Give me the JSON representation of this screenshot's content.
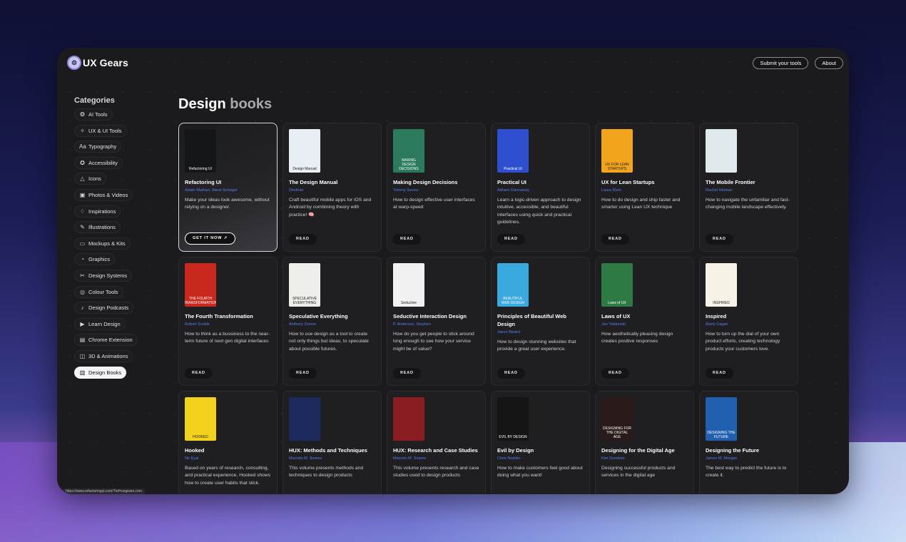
{
  "app": {
    "name": "UX Gears"
  },
  "header": {
    "submit_label": "Submit your tools",
    "about_label": "About"
  },
  "sidebar": {
    "title": "Categories",
    "items": [
      {
        "label": "AI Tools",
        "icon": "ai-icon"
      },
      {
        "label": "UX & UI Tools",
        "icon": "magic-icon"
      },
      {
        "label": "Typography",
        "icon": "typography-icon"
      },
      {
        "label": "Accessibility",
        "icon": "accessibility-icon"
      },
      {
        "label": "Icons",
        "icon": "triangle-icon"
      },
      {
        "label": "Photos & Videos",
        "icon": "photo-icon"
      },
      {
        "label": "Inspirations",
        "icon": "bulb-icon"
      },
      {
        "label": "Illustrations",
        "icon": "brush-icon"
      },
      {
        "label": "Mockups & Kits",
        "icon": "devices-icon"
      },
      {
        "label": "Graphics",
        "icon": "graphics-icon"
      },
      {
        "label": "Design Systems",
        "icon": "components-icon"
      },
      {
        "label": "Colour Tools",
        "icon": "palette-icon"
      },
      {
        "label": "Design Podcasts",
        "icon": "music-icon"
      },
      {
        "label": "Learn Design",
        "icon": "play-icon"
      },
      {
        "label": "Chrome Extension",
        "icon": "browser-icon"
      },
      {
        "label": "3D & Animations",
        "icon": "cube-icon"
      },
      {
        "label": "Design Books",
        "icon": "books-icon",
        "active": true
      }
    ]
  },
  "page": {
    "title_strong": "Design",
    "title_muted": "books"
  },
  "books": [
    {
      "title": "Refactoring UI",
      "author": "Adam Wathan, Steve Schoger",
      "desc": "Make your ideas look awesome, without relying on a designer.",
      "cta": "GET IT NOW",
      "cover_text": "Refactoring UI",
      "cover_color": "#15161a"
    },
    {
      "title": "The Design Manual",
      "author": "Diedrian",
      "desc": "Craft beautiful mobile apps for iOS and Android by combining theory with practice! 🧠",
      "cta": "READ",
      "cover_text": "Design Manual",
      "cover_color": "#e9eef5"
    },
    {
      "title": "Making Design Decisions",
      "author": "Tommy Geoco",
      "desc": "How to design effective user interfaces at warp-speed",
      "cta": "READ",
      "cover_text": "MAKING DESIGN DECISIONS",
      "cover_color": "#2b7a5c"
    },
    {
      "title": "Practical UI",
      "author": "Adham Dannaway",
      "desc": "Learn a logic-driven approach to design intuitive, accessible, and beautiful interfaces using quick and practical guidelines.",
      "cta": "READ",
      "cover_text": "Practical UI",
      "cover_color": "#2f4fd1"
    },
    {
      "title": "UX for Lean Startups",
      "author": "Laura Klein",
      "desc": "How to do design and ship faster and smarter using Lean UX technique",
      "cta": "READ",
      "cover_text": "UX FOR LEAN STARTUPS",
      "cover_color": "#f2a41c"
    },
    {
      "title": "The Mobile Frontier",
      "author": "Rachel Hinman",
      "desc": "How to navigate the unfamiliar and fast-changing mobile landscape effectively.",
      "cta": "READ",
      "cover_text": "",
      "cover_color": "#dfe8ea"
    },
    {
      "title": "The Fourth Transformation",
      "author": "Robert Scoble",
      "desc": "How to think as a bussiness to the near-term future of next gen digital interfaces",
      "cta": "READ",
      "cover_text": "THE FOURTH TRANSFORMATION",
      "cover_color": "#c9281d"
    },
    {
      "title": "Speculative Everything",
      "author": "Anthony Dunne",
      "desc": "How to use design as a tool to create not only things but ideas, to speculate about possible futures.",
      "cta": "READ",
      "cover_text": "SPECULATIVE EVERYTHING",
      "cover_color": "#eeeeea"
    },
    {
      "title": "Seductive Interaction Design",
      "author": "P. Anderson, Stephen",
      "desc": " How do you get people to stick around long enough to see how your service might be of value?",
      "cta": "READ",
      "cover_text": "Seductive",
      "cover_color": "#f1f1f1"
    },
    {
      "title": "Principles of Beautiful Web Design",
      "author": "Jason Beaird",
      "desc": "How to design stunning websites that provide a great user experience.",
      "cta": "READ",
      "cover_text": "BEAUTIFUL WEB DESIGN",
      "cover_color": "#39a9e0"
    },
    {
      "title": "Laws of UX",
      "author": "Jon Yablonski",
      "desc": "How aesthetically pleasing design creates positive responses",
      "cta": "READ",
      "cover_text": "Laws of UX",
      "cover_color": "#2d7a45"
    },
    {
      "title": "Inspired",
      "author": "Marty Cagan",
      "desc": "How to turn up the dial of your own product efforts, creating technology products your customers love.",
      "cta": "READ",
      "cover_text": "INSPIRED",
      "cover_color": "#f7f2e6"
    },
    {
      "title": "Hooked",
      "author": "Nir Eyal",
      "desc": "Based on years of research, consulting, and practical experience, Hooked shows how to create user habits that stick.",
      "cta": "READ",
      "cover_text": "HOOKED",
      "cover_color": "#f3d21d"
    },
    {
      "title": "HUX: Methods and Techniques",
      "author": "Marcelo M. Soares",
      "desc": "This volume presents methods and techniques to design products",
      "cta": "READ",
      "cover_text": "",
      "cover_color": "#1d2a5e"
    },
    {
      "title": "HUX: Research and Case Studies",
      "author": "Marcelo M. Soares",
      "desc": "This volume presents research and case studies used to design products",
      "cta": "READ",
      "cover_text": "",
      "cover_color": "#8a1d22"
    },
    {
      "title": "Evil by Design",
      "author": "Chris Nodder",
      "desc": "How to make customers feel good about doing what you want!",
      "cta": "READ",
      "cover_text": "EVIL BY DESIGN",
      "cover_color": "#151515"
    },
    {
      "title": "Designing for the Digital Age",
      "author": "Kim Goodwin",
      "desc": "Designing successful products and services in the digital age",
      "cta": "READ",
      "cover_text": "DESIGNING FOR THE DIGITAL AGE",
      "cover_color": "#2a1a1a"
    },
    {
      "title": "Designing the Future",
      "author": "James M. Morgan",
      "desc": "The best way to predict the future is to create it.",
      "cta": "READ",
      "cover_text": "DESIGNING THE FUTURE",
      "cover_color": "#1f5fae"
    }
  ],
  "status": {
    "url": "https://www.refactoringui.com/?ref=uxgears.com"
  }
}
